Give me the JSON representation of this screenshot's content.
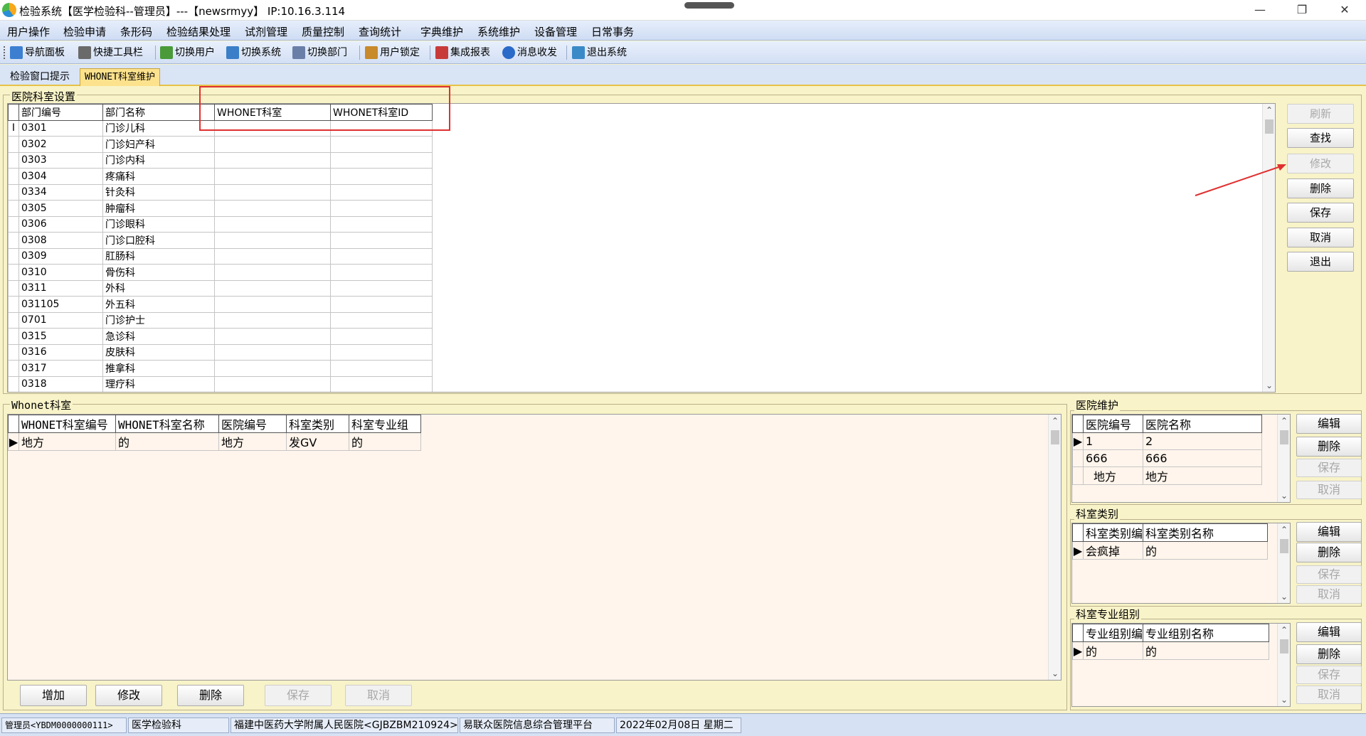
{
  "window": {
    "title": "检验系统【医学检验科--管理员】---【newsrmyy】 IP:10.16.3.114",
    "minimize": "—",
    "restore": "❐",
    "close": "✕"
  },
  "menu": [
    "用户操作",
    "检验申请",
    "条形码",
    "检验结果处理",
    "试剂管理",
    "质量控制",
    "查询统计",
    "字典维护",
    "系统维护",
    "设备管理",
    "日常事务"
  ],
  "toolbar": [
    {
      "label": "导航面板",
      "icon": "navigation-panel-icon",
      "color": "#3c7fd1"
    },
    {
      "label": "快捷工具栏",
      "icon": "quick-toolbar-icon",
      "color": "#6a6a6a"
    },
    {
      "label": "切换用户",
      "icon": "switch-user-icon",
      "color": "#4a9a3a"
    },
    {
      "label": "切换系统",
      "icon": "switch-system-icon",
      "color": "#3a7fc8"
    },
    {
      "label": "切换部门",
      "icon": "switch-department-icon",
      "color": "#6a7fa8"
    },
    {
      "label": "用户锁定",
      "icon": "lock-user-icon",
      "color": "#c88a2a"
    },
    {
      "label": "集成报表",
      "icon": "report-icon",
      "color": "#c83a3a"
    },
    {
      "label": "消息收发",
      "icon": "message-icon",
      "color": "#2a6ac8"
    },
    {
      "label": "退出系统",
      "icon": "exit-icon",
      "color": "#3a8ac8"
    }
  ],
  "tabs": [
    "检验窗口提示",
    "WHONET科室维护"
  ],
  "dept_section": {
    "title": "医院科室设置",
    "columns": [
      "部门编号",
      "部门名称",
      "WHONET科室",
      "WHONET科室ID"
    ],
    "current_indicator": "I",
    "rows": [
      [
        "0301",
        "门诊儿科",
        "",
        ""
      ],
      [
        "0302",
        "门诊妇产科",
        "",
        ""
      ],
      [
        "0303",
        "门诊内科",
        "",
        ""
      ],
      [
        "0304",
        "疼痛科",
        "",
        ""
      ],
      [
        "0334",
        "针灸科",
        "",
        ""
      ],
      [
        "0305",
        "肿瘤科",
        "",
        ""
      ],
      [
        "0306",
        "门诊眼科",
        "",
        ""
      ],
      [
        "0308",
        "门诊口腔科",
        "",
        ""
      ],
      [
        "0309",
        "肛肠科",
        "",
        ""
      ],
      [
        "0310",
        "骨伤科",
        "",
        ""
      ],
      [
        "0311",
        "外科",
        "",
        ""
      ],
      [
        "031105",
        "外五科",
        "",
        ""
      ],
      [
        "0701",
        "门诊护士",
        "",
        ""
      ],
      [
        "0315",
        "急诊科",
        "",
        ""
      ],
      [
        "0316",
        "皮肤科",
        "",
        ""
      ],
      [
        "0317",
        "推拿科",
        "",
        ""
      ],
      [
        "0318",
        "理疗科",
        "",
        ""
      ]
    ]
  },
  "side_buttons": [
    {
      "label": "刷新",
      "enabled": false
    },
    {
      "label": "查找",
      "enabled": true
    },
    {
      "label": "修改",
      "enabled": false
    },
    {
      "label": "删除",
      "enabled": true
    },
    {
      "label": "保存",
      "enabled": true
    },
    {
      "label": "取消",
      "enabled": true
    },
    {
      "label": "退出",
      "enabled": true
    }
  ],
  "whonet_section": {
    "title": "Whonet科室",
    "columns": [
      "WHONET科室编号",
      "WHONET科室名称",
      "医院编号",
      "科室类别",
      "科室专业组"
    ],
    "rows": [
      [
        "地方",
        "的",
        "地方",
        "发GV",
        "的"
      ]
    ]
  },
  "bottom_buttons": [
    {
      "label": "增加",
      "enabled": true
    },
    {
      "label": "修改",
      "enabled": true
    },
    {
      "label": "删除",
      "enabled": true
    },
    {
      "label": "保存",
      "enabled": false
    },
    {
      "label": "取消",
      "enabled": false
    }
  ],
  "hospital_section": {
    "title": "医院维护",
    "columns": [
      "医院编号",
      "医院名称"
    ],
    "rows": [
      [
        "1",
        "2"
      ],
      [
        "666",
        "666"
      ],
      [
        "地方",
        "地方"
      ]
    ]
  },
  "category_section": {
    "title": "科室类别",
    "columns": [
      "科室类别编号",
      "科室类别名称"
    ],
    "rows": [
      [
        "会疯掉",
        "的"
      ]
    ]
  },
  "group_section": {
    "title": "科室专业组别",
    "columns": [
      "专业组别编号",
      "专业组别名称"
    ],
    "rows": [
      [
        "的",
        "的"
      ]
    ]
  },
  "small_buttons": [
    {
      "label": "编辑",
      "enabled": true
    },
    {
      "label": "删除",
      "enabled": true
    },
    {
      "label": "保存",
      "enabled": false
    },
    {
      "label": "取消",
      "enabled": false
    }
  ],
  "status": [
    "管理员<YBDM0000000111>",
    "医学检验科",
    "福建中医药大学附属人民医院<GJBZBM210924>",
    "易联众医院信息综合管理平台",
    "2022年02月08日 星期二"
  ],
  "colors": {
    "accent_tab": "#fde28d",
    "panel_bg": "#f8f3c8",
    "grid_bg": "#fff5ec",
    "highlight": "#e03030"
  }
}
